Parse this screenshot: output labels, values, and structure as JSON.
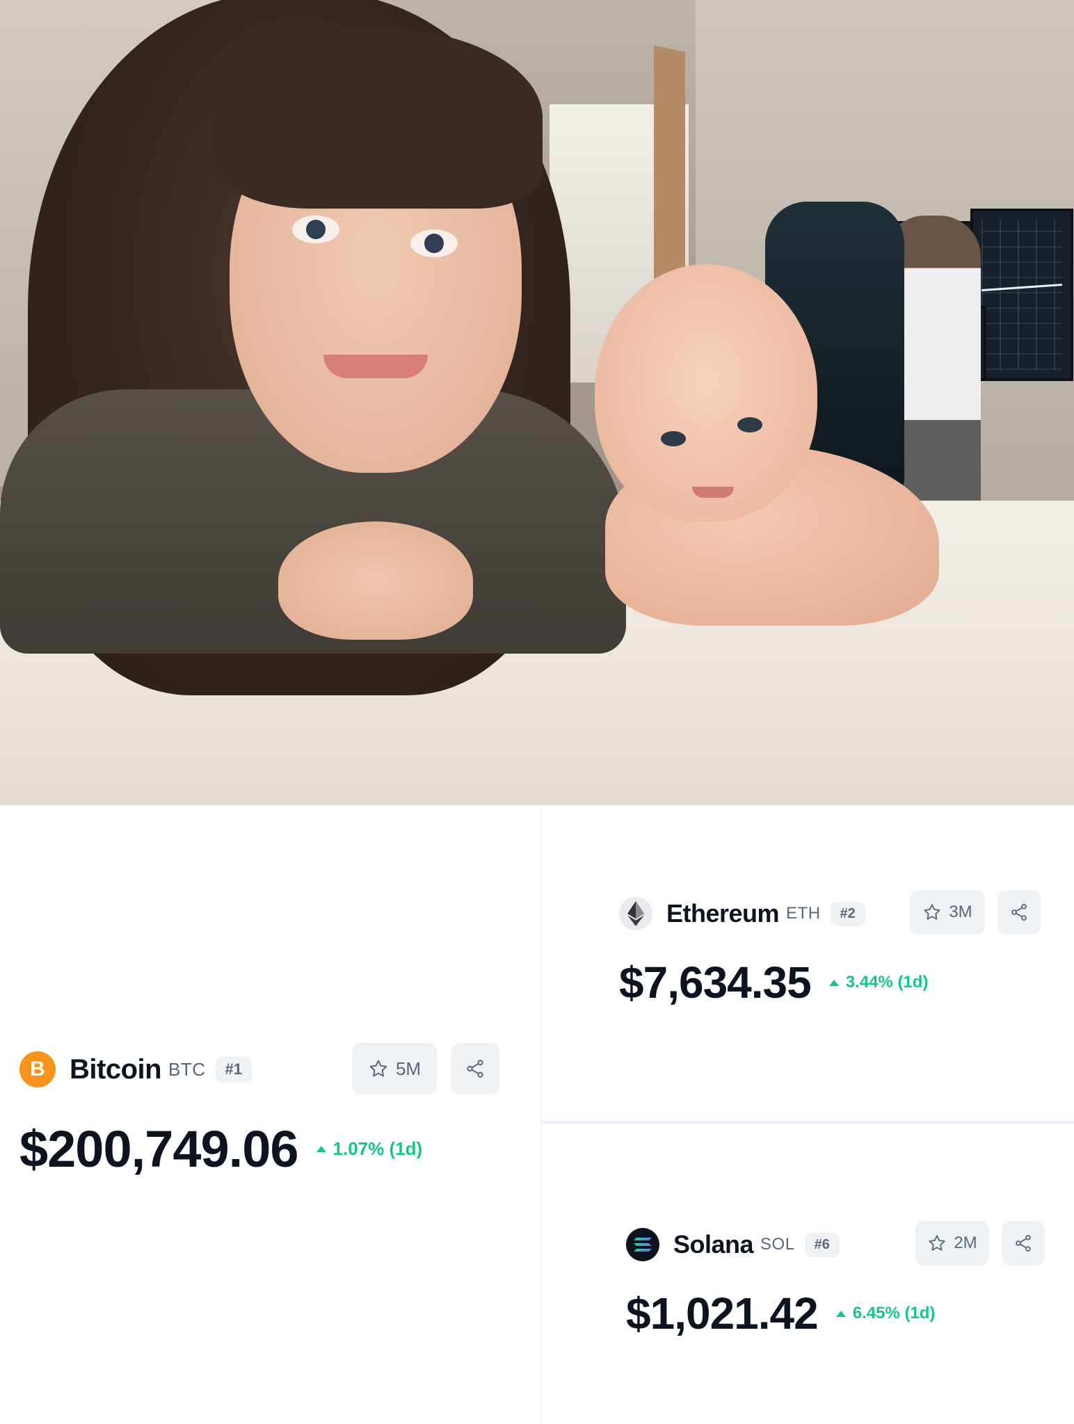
{
  "photo": {
    "icon": "photo-of-woman-baby-and-man-at-trading-monitors"
  },
  "coins": {
    "bitcoin": {
      "name": "Bitcoin",
      "symbol": "BTC",
      "rank": "#1",
      "watchlist": "5M",
      "price": "$200,749.06",
      "change": "1.07% (1d)",
      "logo_glyph": "B",
      "logo_color": "#f7931a"
    },
    "ethereum": {
      "name": "Ethereum",
      "symbol": "ETH",
      "rank": "#2",
      "watchlist": "3M",
      "price": "$7,634.35",
      "change": "3.44% (1d)",
      "logo_color": "#e8eaef"
    },
    "solana": {
      "name": "Solana",
      "symbol": "SOL",
      "rank": "#6",
      "watchlist": "2M",
      "price": "$1,021.42",
      "change": "6.45% (1d)",
      "logo_color": "#0d1421"
    }
  },
  "colors": {
    "positive": "#16c784",
    "text_primary": "#0d1421",
    "text_secondary": "#58667e",
    "button_bg": "#eff2f5"
  }
}
